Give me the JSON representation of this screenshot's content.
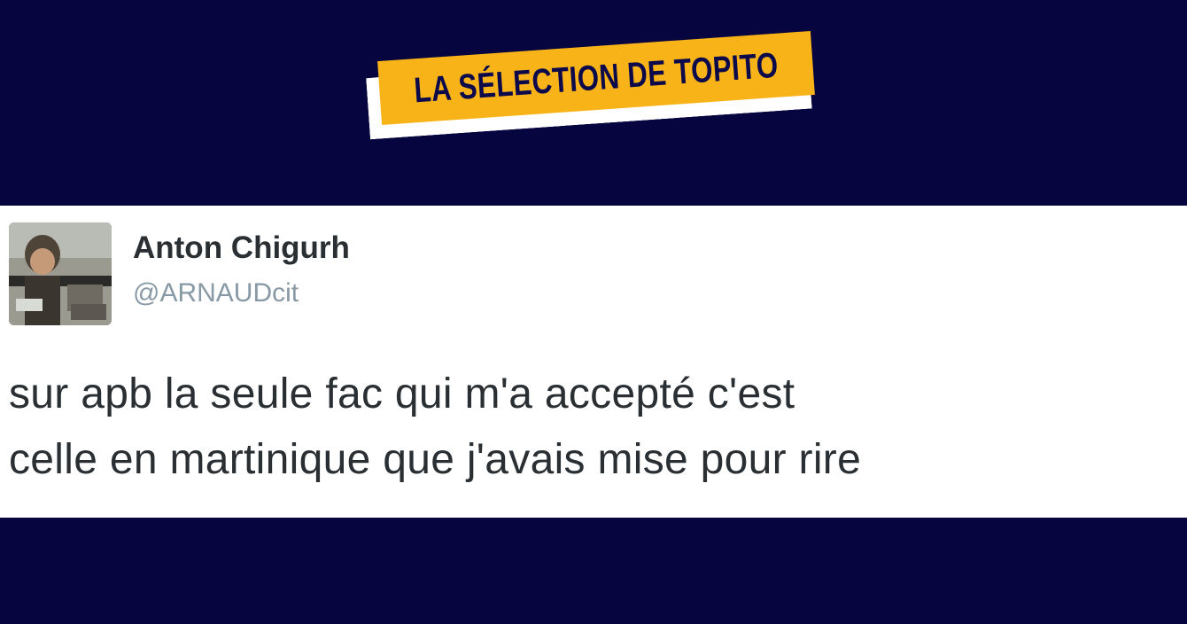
{
  "banner": {
    "label": "LA SÉLECTION DE TOPITO"
  },
  "tweet": {
    "author_name": "Anton Chigurh",
    "author_handle": "@ARNAUDcit",
    "text": "sur apb la seule fac qui m'a accepté c'est\ncelle en martinique que j'avais mise pour rire"
  },
  "icons": {
    "avatar": "user-photo"
  },
  "colors": {
    "background": "#06053f",
    "banner_yellow": "#f7b317",
    "banner_text": "#0c0a4a",
    "card": "#ffffff",
    "name_text": "#292f33",
    "handle_text": "#8899a6"
  }
}
